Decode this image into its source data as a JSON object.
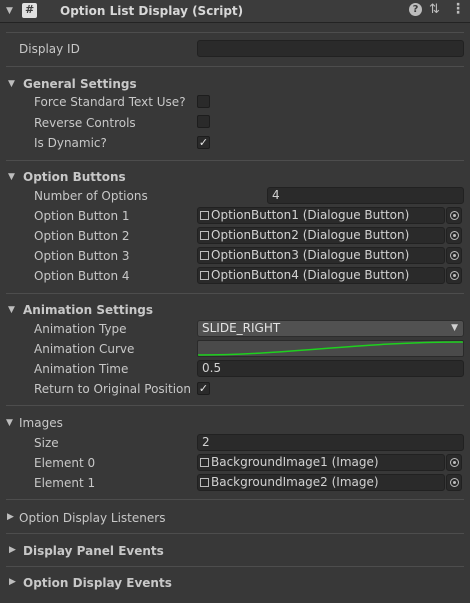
{
  "header": {
    "title": "Option List Display (Script)",
    "enabled": true
  },
  "display_id": {
    "label": "Display ID",
    "value": ""
  },
  "general": {
    "title": "General Settings",
    "force_standard_text": {
      "label": "Force Standard Text Use?",
      "checked": false
    },
    "reverse_controls": {
      "label": "Reverse Controls",
      "checked": false
    },
    "is_dynamic": {
      "label": "Is Dynamic?",
      "checked": true,
      "mark": "✓"
    }
  },
  "option_buttons": {
    "title": "Option Buttons",
    "number_label": "Number of Options",
    "number_value": "4",
    "items": [
      {
        "label": "Option Button 1",
        "value": "OptionButton1 (Dialogue Button)"
      },
      {
        "label": "Option Button 2",
        "value": "OptionButton2 (Dialogue Button)"
      },
      {
        "label": "Option Button 3",
        "value": "OptionButton3 (Dialogue Button)"
      },
      {
        "label": "Option Button 4",
        "value": "OptionButton4 (Dialogue Button)"
      }
    ]
  },
  "animation": {
    "title": "Animation Settings",
    "type_label": "Animation Type",
    "type_value": "SLIDE_RIGHT",
    "curve_label": "Animation Curve",
    "time_label": "Animation Time",
    "time_value": "0.5",
    "return_label": "Return to Original Position",
    "return_checked": true,
    "return_mark": "✓",
    "curve_color": "#1ed01e"
  },
  "images": {
    "title": "Images",
    "size_label": "Size",
    "size_value": "2",
    "items": [
      {
        "label": "Element 0",
        "value": "BackgroundImage1 (Image)"
      },
      {
        "label": "Element 1",
        "value": "BackgroundImage2 (Image)"
      }
    ]
  },
  "collapsed_sections": {
    "listeners": "Option Display Listeners",
    "panel_events": "Display Panel Events",
    "display_events": "Option Display Events"
  },
  "icons": {
    "script": "script-icon",
    "help": "help-icon",
    "presets": "presets-icon",
    "more": "kebab-menu-icon",
    "expand": "expand-arrow-icon",
    "collapse": "collapse-arrow-icon",
    "picker": "object-picker-icon"
  }
}
